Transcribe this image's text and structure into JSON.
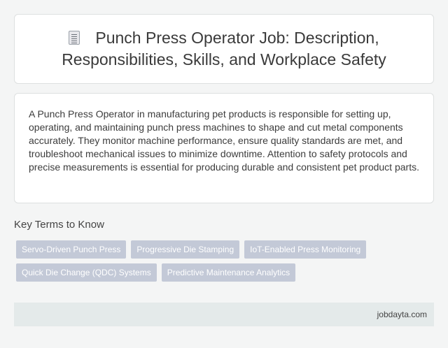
{
  "header": {
    "icon": "document-icon",
    "title": "Punch Press Operator Job: Description, Responsibilities, Skills, and Workplace Safety"
  },
  "description": {
    "text": "A Punch Press Operator in manufacturing pet products is responsible for setting up, operating, and maintaining punch press machines to shape and cut metal components accurately. They monitor machine performance, ensure quality standards are met, and troubleshoot mechanical issues to minimize downtime. Attention to safety protocols and precise measurements is essential for producing durable and consistent pet product parts."
  },
  "key_terms": {
    "title": "Key Terms to Know",
    "tags": [
      "Servo-Driven Punch Press",
      "Progressive Die Stamping",
      "IoT-Enabled Press Monitoring",
      "Quick Die Change (QDC) Systems",
      "Predictive Maintenance Analytics"
    ]
  },
  "footer": {
    "site": "jobdayta.com"
  },
  "colors": {
    "tag_background": "#c3c9d7",
    "footer_background": "#e4eaea",
    "page_background": "#f4f5f5"
  }
}
